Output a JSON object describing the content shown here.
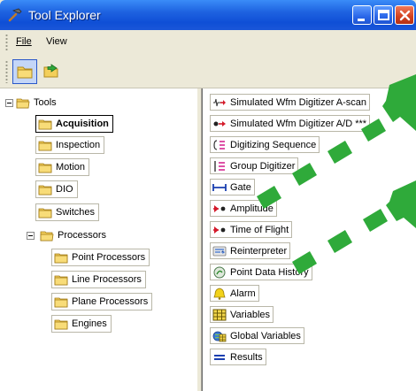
{
  "window": {
    "title": "Tool Explorer"
  },
  "menu": {
    "file": "File",
    "view": "View"
  },
  "toolbar": {
    "icons": [
      "folder-icon",
      "export-icon"
    ]
  },
  "tree": {
    "root": "Tools",
    "acquisition": "Acquisition",
    "inspection": "Inspection",
    "motion": "Motion",
    "dio": "DIO",
    "switches": "Switches",
    "processors": "Processors",
    "point_processors": "Point Processors",
    "line_processors": "Line Processors",
    "plane_processors": "Plane Processors",
    "engines": "Engines"
  },
  "list": {
    "items": [
      {
        "label": "Simulated Wfm Digitizer A-scan",
        "icon": "ascan-icon"
      },
      {
        "label": "Simulated Wfm Digitizer A/D ***",
        "icon": "ad-icon"
      },
      {
        "label": "Digitizing Sequence",
        "icon": "sequence-icon"
      },
      {
        "label": "Group Digitizer",
        "icon": "group-digitizer-icon"
      },
      {
        "label": "Gate",
        "icon": "gate-icon"
      },
      {
        "label": "Amplitude",
        "icon": "amplitude-icon"
      },
      {
        "label": "Time of Flight",
        "icon": "time-of-flight-icon"
      },
      {
        "label": "Reinterpreter",
        "icon": "reinterpreter-icon"
      },
      {
        "label": "Point Data History",
        "icon": "history-icon"
      },
      {
        "label": "Alarm",
        "icon": "alarm-icon"
      },
      {
        "label": "Variables",
        "icon": "variables-icon"
      },
      {
        "label": "Global Variables",
        "icon": "global-variables-icon"
      },
      {
        "label": "Results",
        "icon": "results-icon"
      }
    ]
  },
  "colors": {
    "titlebar": "#1e62e0",
    "highlight_arrows": "#2faa3a"
  }
}
